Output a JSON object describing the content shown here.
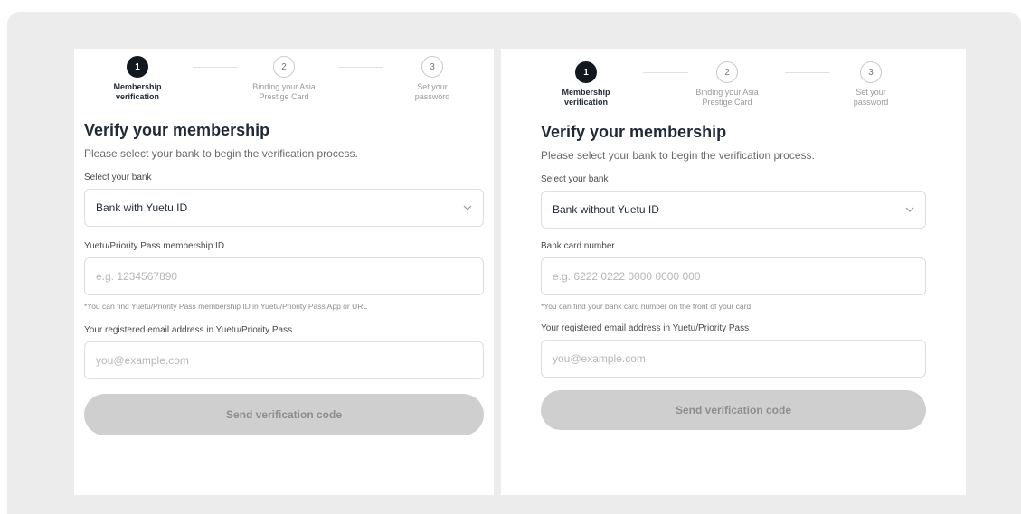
{
  "steps": [
    {
      "number": "1",
      "label_line1": "Membership",
      "label_line2": "verification"
    },
    {
      "number": "2",
      "label_line1": "Binding your Asia",
      "label_line2": "Prestige Card"
    },
    {
      "number": "3",
      "label_line1": "Set your",
      "label_line2": "password"
    }
  ],
  "left_form": {
    "title": "Verify your membership",
    "subtitle": "Please select your bank to begin the verification process.",
    "bank_label": "Select your bank",
    "bank_value": "Bank with Yuetu ID",
    "id_label": "Yuetu/Priority Pass membership ID",
    "id_placeholder": "e.g. 1234567890",
    "id_hint": "*You can find Yuetu/Priority Pass membership ID in Yuetu/Priority Pass App or URL",
    "email_label": "Your registered email address in Yuetu/Priority Pass",
    "email_placeholder": "you@example.com",
    "send_label": "Send verification code"
  },
  "right_form": {
    "title": "Verify your membership",
    "subtitle": "Please select your bank to begin the verification process.",
    "bank_label": "Select your bank",
    "bank_value": "Bank without Yuetu ID",
    "card_label": "Bank card number",
    "card_placeholder": "e.g. 6222 0222 0000 0000 000",
    "card_hint": "*You can find your bank card number on the front of your card",
    "email_label": "Your registered email address in Yuetu/Priority Pass",
    "email_placeholder": "you@example.com",
    "send_label": "Send verification code"
  },
  "colors": {
    "active_step": "#111820",
    "disabled_button": "#cfcfcf",
    "background": "#ececec"
  }
}
